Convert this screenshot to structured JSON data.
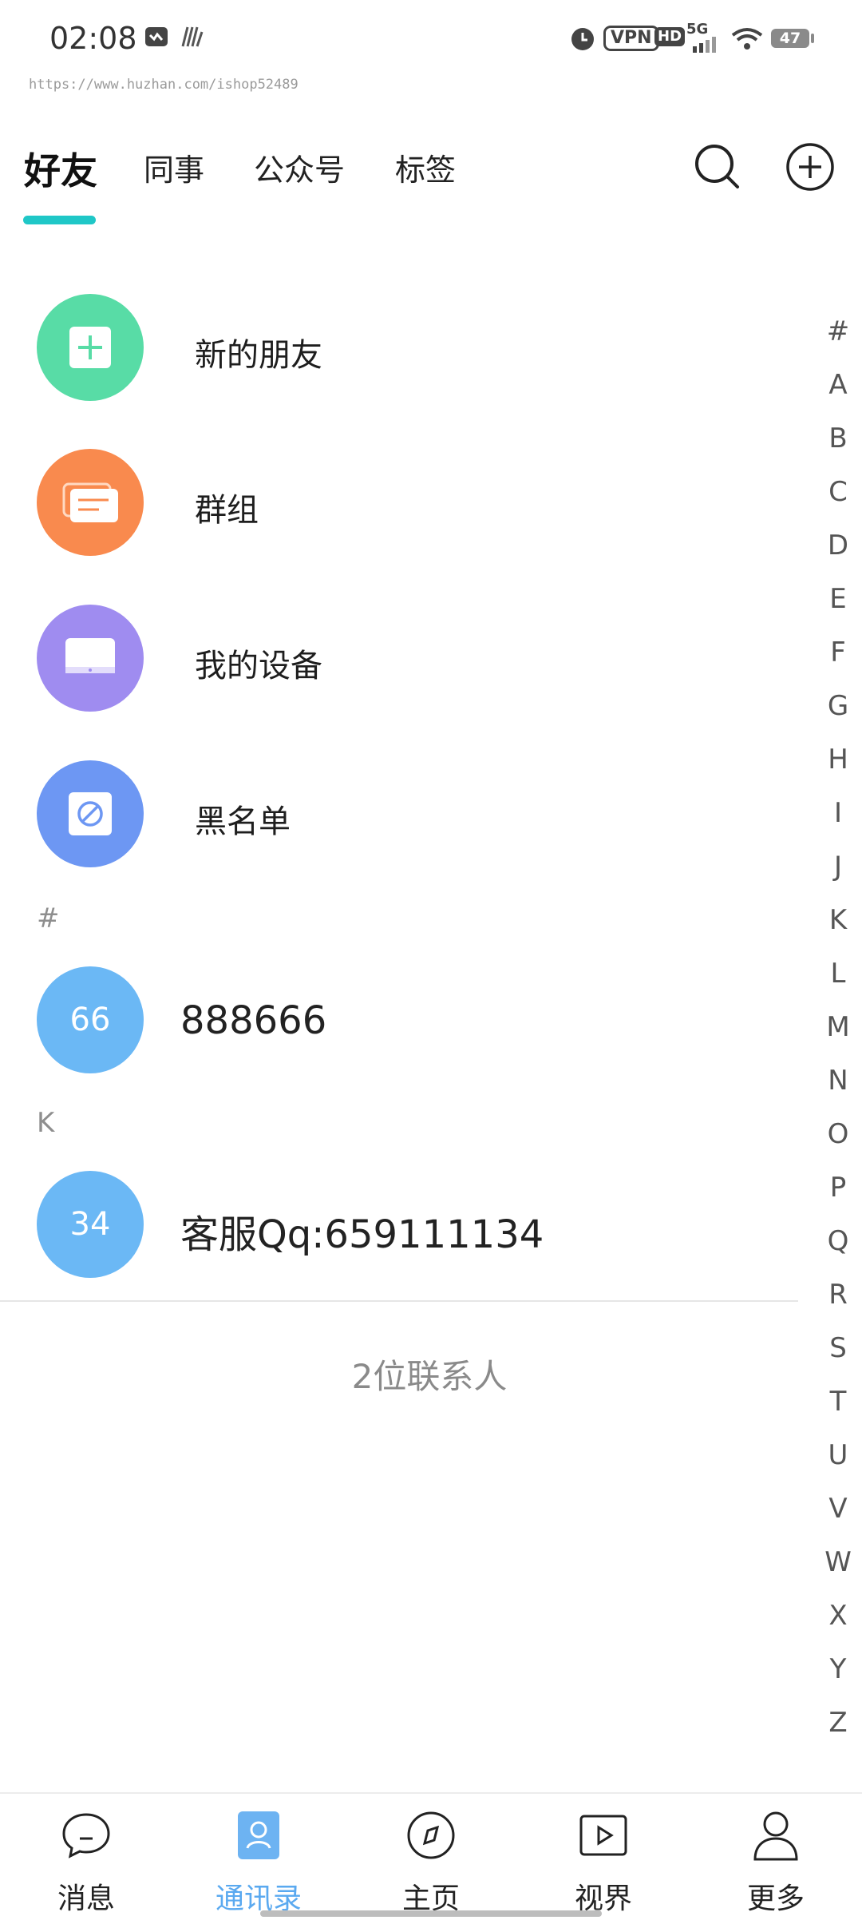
{
  "status_bar": {
    "time": "02:08",
    "vpn_label": "VPN",
    "hd_label": "HD",
    "network": "5G",
    "battery": "47"
  },
  "watermark": "https://www.huzhan.com/ishop52489",
  "tabs": [
    {
      "label": "好友",
      "active": true
    },
    {
      "label": "同事",
      "active": false
    },
    {
      "label": "公众号",
      "active": false
    },
    {
      "label": "标签",
      "active": false
    }
  ],
  "header_icons": [
    "search-icon",
    "add-circle-icon"
  ],
  "functions": [
    {
      "label": "新的朋友",
      "icon": "plus-icon",
      "color": "#58dca6"
    },
    {
      "label": "群组",
      "icon": "chat-bubble-icon",
      "color": "#f98a4e"
    },
    {
      "label": "我的设备",
      "icon": "monitor-icon",
      "color": "#9f8cf0"
    },
    {
      "label": "黑名单",
      "icon": "block-icon",
      "color": "#6d97f3"
    }
  ],
  "sections": [
    {
      "letter": "#",
      "contacts": [
        {
          "avatar_text": "66",
          "name": "888666"
        }
      ]
    },
    {
      "letter": "K",
      "contacts": [
        {
          "avatar_text": "34",
          "name": "客服Qq:659111134"
        }
      ]
    }
  ],
  "contact_count": "2位联系人",
  "index_letters": [
    "#",
    "A",
    "B",
    "C",
    "D",
    "E",
    "F",
    "G",
    "H",
    "I",
    "J",
    "K",
    "L",
    "M",
    "N",
    "O",
    "P",
    "Q",
    "R",
    "S",
    "T",
    "U",
    "V",
    "W",
    "X",
    "Y",
    "Z"
  ],
  "bottom_nav": [
    {
      "label": "消息",
      "icon": "message-icon",
      "active": false
    },
    {
      "label": "通讯录",
      "icon": "contacts-icon",
      "active": true
    },
    {
      "label": "主页",
      "icon": "compass-icon",
      "active": false
    },
    {
      "label": "视界",
      "icon": "video-play-icon",
      "active": false
    },
    {
      "label": "更多",
      "icon": "person-icon",
      "active": false
    }
  ],
  "colors": {
    "accent": "#1fc7c7",
    "nav_active": "#5aa9f0",
    "contact_avatar": "#6bb8f5"
  }
}
